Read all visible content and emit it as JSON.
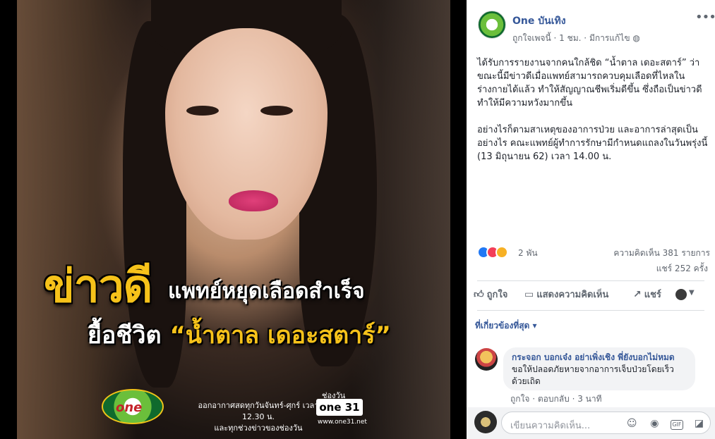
{
  "photo": {
    "headline_big": "ข่าวดี",
    "headline_sub1": "แพทย์หยุดเลือดสำเร็จ",
    "headline_sub2_prefix": "ยื้อชีวิต",
    "headline_sub2_name": "“น้ำตาล เดอะสตาร์”",
    "logo_text": "one",
    "air_text_1": "ออกอากาศสดทุกวันจันทร์-ศุกร์ เวลา 12.30 น.",
    "air_text_2": "และทุกช่วงข่าวของช่องวัน",
    "channel_label": "ช่องวัน",
    "channel_box": "one 31",
    "channel_url": "www.one31.net"
  },
  "post": {
    "page_name": "One บันเทิง",
    "meta_liked": "ถูกใจเพจนี้",
    "meta_time": "1 ชม.",
    "meta_edited": "มีการแก้ไข",
    "text": "ได้รับการรายงานจากคนใกล้ชิด “น้ำตาล เดอะสตาร์” ว่าขณะนี้มีข่าวดีเมื่อแพทย์สามารถควบคุมเลือดที่ไหลในร่างกายได้แล้ว ทำให้สัญญาณชีพเริ่มดีขึ้น ซึ่งถือเป็นข่าวดีทำให้มีความหวังมากขึ้น\n\nอย่างไรก็ตามสาเหตุของอาการป่วย และอาการล่าสุดเป็นอย่างไร คณะแพทย์ผู้ทำการรักษามีกำหนดแถลงในวันพรุ่งนี้ (13 มิถุนายน 62) เวลา 14.00 น.",
    "reaction_count": "2 พัน",
    "comment_count": "ความคิดเห็น 381 รายการ",
    "share_count": "แชร์ 252 ครั้ง"
  },
  "actions": {
    "like": "ถูกใจ",
    "comment": "แสดงความคิดเห็น",
    "share": "แชร์"
  },
  "comments": {
    "filter": "ที่เกี่ยวข้องที่สุด",
    "items": [
      {
        "author": "กระจอก บอกเจ๋ง อย่าเพิ่งเชิง พี่ยังบอกไม่หมด",
        "text": "ขอให้ปลอดภัยหายจากอาการเจ็บป่วยโดยเร็วด้วยเถิด",
        "like": "ถูกใจ",
        "reply": "ตอบกลับ",
        "time": "3 นาที"
      }
    ],
    "input_placeholder": "เขียนความคิดเห็น..."
  },
  "colors": {
    "link": "#365899",
    "headline_yellow": "#f6c21a",
    "like_blue": "#2078f4",
    "love_red": "#f33e58",
    "sad_yellow": "#f7b125"
  },
  "icons": [
    "more-options-icon",
    "globe-icon",
    "like-reaction-icon",
    "love-reaction-icon",
    "sad-reaction-icon",
    "thumb-up-icon",
    "comment-icon",
    "share-icon",
    "caret-down-icon",
    "emoji-icon",
    "camera-icon",
    "gif-icon",
    "sticker-icon"
  ]
}
